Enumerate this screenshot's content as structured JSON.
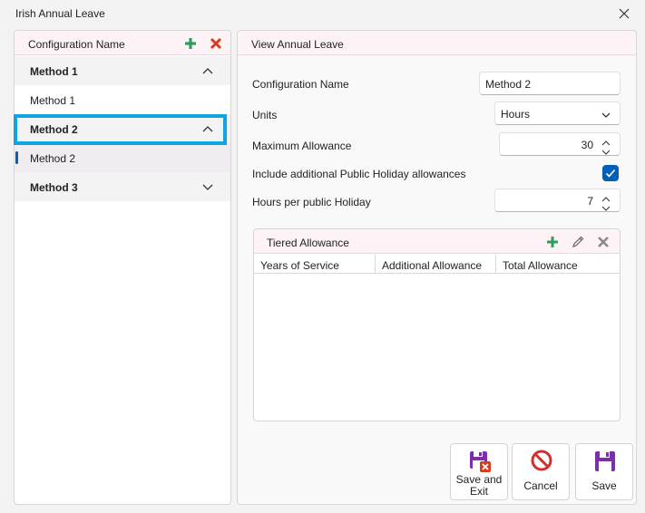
{
  "window": {
    "title": "Irish Annual Leave"
  },
  "left_panel": {
    "header": "Configuration Name",
    "groups": [
      {
        "header": "Method 1",
        "items": [
          "Method 1"
        ],
        "expanded": true
      },
      {
        "header": "Method 2",
        "items": [
          "Method 2"
        ],
        "expanded": true,
        "focused": true,
        "selected_item": "Method 2"
      },
      {
        "header": "Method 3",
        "items": [],
        "expanded": false
      }
    ]
  },
  "right_panel": {
    "header": "View Annual Leave",
    "configuration_name": {
      "label": "Configuration Name",
      "value": "Method 2"
    },
    "units": {
      "label": "Units",
      "value": "Hours"
    },
    "max_allowance": {
      "label": "Maximum Allowance",
      "value": "30"
    },
    "include_ph": {
      "label": "Include additional Public Holiday allowances",
      "checked": true
    },
    "hours_per_ph": {
      "label": "Hours per public Holiday",
      "value": "7"
    },
    "tiered": {
      "header": "Tiered Allowance",
      "columns": [
        "Years of Service",
        "Additional Allowance",
        "Total Allowance"
      ],
      "rows": []
    }
  },
  "buttons": {
    "save_exit": "Save and Exit",
    "save_exit_line1": "Save and",
    "save_exit_line2": "Exit",
    "cancel": "Cancel",
    "save": "Save"
  },
  "colors": {
    "accent": "#005fb8",
    "focus": "#0ea5e0",
    "add": "#2e9e5b",
    "delete": "#d83b1c",
    "save_icon": "#7b2fa8",
    "cancel_icon": "#d32f2f"
  }
}
